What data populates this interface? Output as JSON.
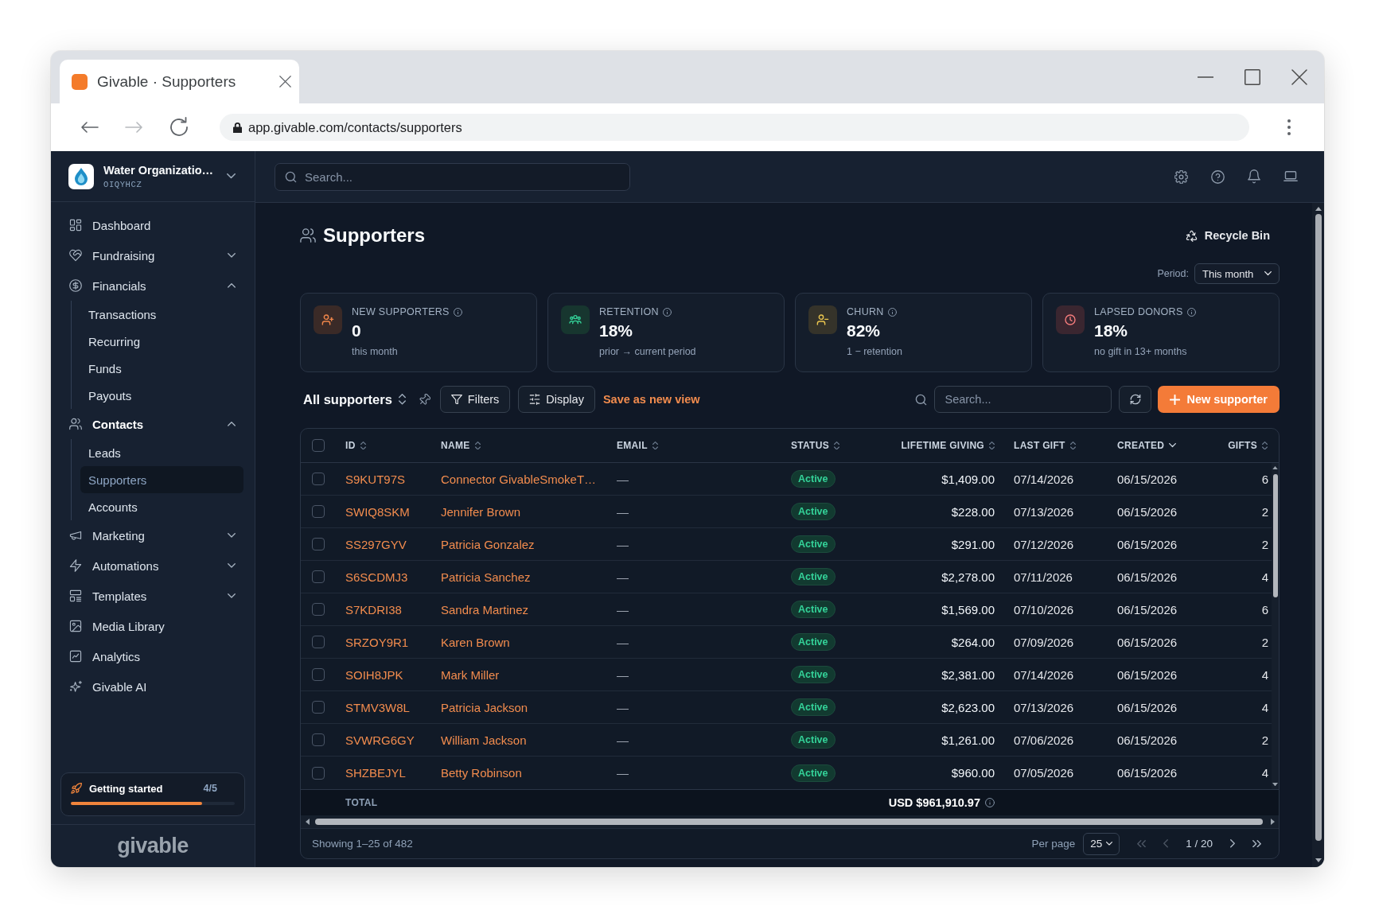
{
  "browser": {
    "tab": {
      "title": "Givable · Supporters"
    },
    "url": "app.givable.com/contacts/supporters"
  },
  "sidebar": {
    "org": {
      "name": "Water Organizatio…",
      "code": "OIQYHCZ"
    },
    "items": [
      {
        "kind": "link",
        "label": "Dashboard",
        "selected": false
      },
      {
        "kind": "group",
        "label": "Fundraising",
        "selected": false,
        "expanded": false
      },
      {
        "kind": "group",
        "label": "Financials",
        "selected": false,
        "expanded": true,
        "children": [
          {
            "label": "Transactions",
            "selected": false
          },
          {
            "label": "Recurring",
            "selected": false
          },
          {
            "label": "Funds",
            "selected": false
          },
          {
            "label": "Payouts",
            "selected": false
          }
        ]
      },
      {
        "kind": "group",
        "label": "Contacts",
        "selected": false,
        "expanded": true,
        "children": [
          {
            "label": "Leads",
            "selected": false
          },
          {
            "label": "Supporters",
            "selected": true
          },
          {
            "label": "Accounts",
            "selected": false
          }
        ]
      },
      {
        "kind": "group",
        "label": "Marketing",
        "selected": false,
        "expanded": false
      },
      {
        "kind": "group",
        "label": "Automations",
        "selected": false,
        "expanded": false
      },
      {
        "kind": "group",
        "label": "Templates",
        "selected": false,
        "expanded": false
      },
      {
        "kind": "link",
        "label": "Media Library",
        "selected": false
      },
      {
        "kind": "link",
        "label": "Analytics",
        "selected": false
      },
      {
        "kind": "link",
        "label": "Givable AI",
        "selected": false
      }
    ],
    "getting_started": {
      "label": "Getting started",
      "progress": "4/5",
      "level": 0.8
    },
    "logo": "givable"
  },
  "topbar": {
    "search": {
      "placeholder": "Search..."
    }
  },
  "page": {
    "title": "Supporters",
    "recycle_button": "Recycle Bin",
    "period": {
      "label": "Period:",
      "value": "This month"
    }
  },
  "stats": [
    {
      "label": "NEW SUPPORTERS",
      "value": "0",
      "caption": "this month"
    },
    {
      "label": "RETENTION",
      "value": "18%",
      "caption": "prior → current period"
    },
    {
      "label": "CHURN",
      "value": "82%",
      "caption": "1 − retention"
    },
    {
      "label": "LAPSED DONORS",
      "value": "18%",
      "caption": "no gift in 13+ months"
    }
  ],
  "toolbar": {
    "view": "All supporters",
    "filters_button": "Filters",
    "display_button": "Display",
    "save_view_link": "Save as new view",
    "search": {
      "placeholder": "Search..."
    },
    "new_button": "New supporter"
  },
  "table": {
    "select_all": {
      "checked": false
    },
    "columns": [
      {
        "label": "ID",
        "sorted": false
      },
      {
        "label": "NAME",
        "sorted": false
      },
      {
        "label": "EMAIL",
        "sorted": false
      },
      {
        "label": "STATUS",
        "sorted": false
      },
      {
        "label": "LIFETIME GIVING",
        "sorted": false
      },
      {
        "label": "LAST GIFT",
        "sorted": false
      },
      {
        "label": "CREATED",
        "sorted": true
      },
      {
        "label": "GIFTS",
        "sorted": false
      }
    ],
    "rows": [
      {
        "checked": false,
        "id": "S9KUT97S",
        "name": "Connector GivableSmokeT…",
        "email": "—",
        "status": "Active",
        "lifetime_giving": "$1,409.00",
        "last_gift": "07/14/2026",
        "created": "06/15/2026",
        "gifts": "6"
      },
      {
        "checked": false,
        "id": "SWIQ8SKM",
        "name": "Jennifer Brown",
        "email": "—",
        "status": "Active",
        "lifetime_giving": "$228.00",
        "last_gift": "07/13/2026",
        "created": "06/15/2026",
        "gifts": "2"
      },
      {
        "checked": false,
        "id": "SS297GYV",
        "name": "Patricia Gonzalez",
        "email": "—",
        "status": "Active",
        "lifetime_giving": "$291.00",
        "last_gift": "07/12/2026",
        "created": "06/15/2026",
        "gifts": "2"
      },
      {
        "checked": false,
        "id": "S6SCDMJ3",
        "name": "Patricia Sanchez",
        "email": "—",
        "status": "Active",
        "lifetime_giving": "$2,278.00",
        "last_gift": "07/11/2026",
        "created": "06/15/2026",
        "gifts": "4"
      },
      {
        "checked": false,
        "id": "S7KDRI38",
        "name": "Sandra Martinez",
        "email": "—",
        "status": "Active",
        "lifetime_giving": "$1,569.00",
        "last_gift": "07/10/2026",
        "created": "06/15/2026",
        "gifts": "6"
      },
      {
        "checked": false,
        "id": "SRZOY9R1",
        "name": "Karen Brown",
        "email": "—",
        "status": "Active",
        "lifetime_giving": "$264.00",
        "last_gift": "07/09/2026",
        "created": "06/15/2026",
        "gifts": "2"
      },
      {
        "checked": false,
        "id": "SOIH8JPK",
        "name": "Mark Miller",
        "email": "—",
        "status": "Active",
        "lifetime_giving": "$2,381.00",
        "last_gift": "07/14/2026",
        "created": "06/15/2026",
        "gifts": "4"
      },
      {
        "checked": false,
        "id": "STMV3W8L",
        "name": "Patricia Jackson",
        "email": "—",
        "status": "Active",
        "lifetime_giving": "$2,623.00",
        "last_gift": "07/13/2026",
        "created": "06/15/2026",
        "gifts": "4"
      },
      {
        "checked": false,
        "id": "SVWRG6GY",
        "name": "William Jackson",
        "email": "—",
        "status": "Active",
        "lifetime_giving": "$1,261.00",
        "last_gift": "07/06/2026",
        "created": "06/15/2026",
        "gifts": "2"
      },
      {
        "checked": false,
        "id": "SHZBEJYL",
        "name": "Betty Robinson",
        "email": "—",
        "status": "Active",
        "lifetime_giving": "$960.00",
        "last_gift": "07/05/2026",
        "created": "06/15/2026",
        "gifts": "4"
      }
    ],
    "total": {
      "label": "TOTAL",
      "value": "USD $961,910.97"
    },
    "pagination": {
      "summary": "Showing 1–25 of 482",
      "per_page_label": "Per page",
      "per_page": "25",
      "page": "1 / 20",
      "controls": [
        {
          "disabled": true
        },
        {
          "disabled": true
        },
        {
          "disabled": false
        },
        {
          "disabled": false
        }
      ]
    }
  }
}
